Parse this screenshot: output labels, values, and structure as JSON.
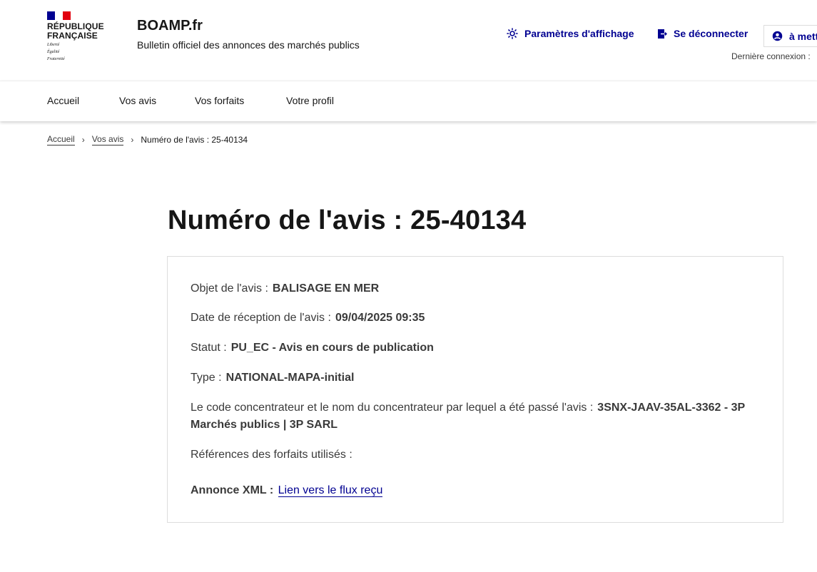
{
  "header": {
    "republic_line1": "RÉPUBLIQUE",
    "republic_line2": "FRANÇAISE",
    "motto1": "Liberté",
    "motto2": "Égalité",
    "motto3": "Fraternité",
    "site_title": "BOAMP.fr",
    "site_subtitle": "Bulletin officiel des annonces des marchés publics",
    "tool_display": "Paramètres d'affichage",
    "tool_logout": "Se déconnecter",
    "tool_account": "à mett",
    "last_connection": "Dernière connexion :"
  },
  "nav": {
    "items": [
      "Accueil",
      "Vos avis",
      "Vos forfaits",
      "Votre profil"
    ]
  },
  "breadcrumb": {
    "home": "Accueil",
    "notices": "Vos avis",
    "current": "Numéro de l'avis : 25-40134"
  },
  "main": {
    "title": "Numéro de l'avis : 25-40134",
    "object_label": "Objet de l'avis :",
    "object_value": "BALISAGE EN MER",
    "date_label": "Date de réception de l'avis :",
    "date_value": "09/04/2025 09:35",
    "status_label": "Statut :",
    "status_value": "PU_EC - Avis en cours de publication",
    "type_label": "Type :",
    "type_value": "NATIONAL-MAPA-initial",
    "concentrator_label": "Le code concentrateur et le nom du concentrateur par lequel a été passé l'avis :",
    "concentrator_value": "3SNX-JAAV-35AL-3362 - 3P Marchés publics | 3P SARL",
    "refs_label": "Références des forfaits utilisés :",
    "xml_label": "Annonce XML :",
    "xml_link": "Lien vers le flux reçu"
  },
  "colors": {
    "brand_blue": "#000091",
    "brand_red": "#e1000f",
    "text": "#161616",
    "text_muted": "#3a3a3a",
    "border": "#dddddd"
  },
  "icons": {
    "display": "sun-icon",
    "logout": "logout-icon",
    "account": "user-icon"
  }
}
